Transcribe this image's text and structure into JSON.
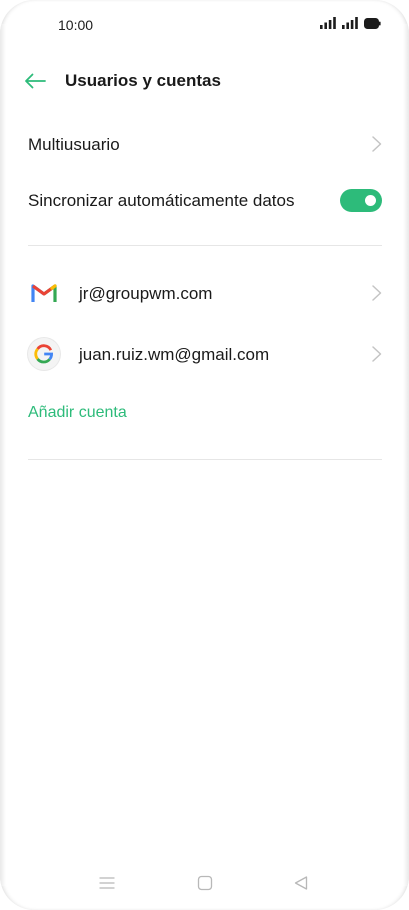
{
  "status_bar": {
    "time": "10:00",
    "icons": [
      "signal-icon",
      "signal-icon",
      "battery-icon"
    ]
  },
  "header": {
    "back_icon": "arrow-left-icon",
    "title": "Usuarios y cuentas"
  },
  "settings": {
    "multiuser_label": "Multiusuario",
    "sync_label": "Sincronizar automáticamente datos",
    "sync_enabled": true
  },
  "accounts": [
    {
      "icon": "gmail-icon",
      "label": "jr@groupwm.com"
    },
    {
      "icon": "google-icon",
      "label": "juan.ruiz.wm@gmail.com"
    }
  ],
  "add_account_label": "Añadir cuenta",
  "nav_bar": {
    "icons": [
      "menu-icon",
      "home-icon",
      "back-triangle-icon"
    ]
  },
  "colors": {
    "accent": "#2dbb7a",
    "text": "#1a1a1a",
    "divider": "#e6e6e6",
    "chevron": "#c4c4c4",
    "nav_icon": "#b8b8b8"
  }
}
